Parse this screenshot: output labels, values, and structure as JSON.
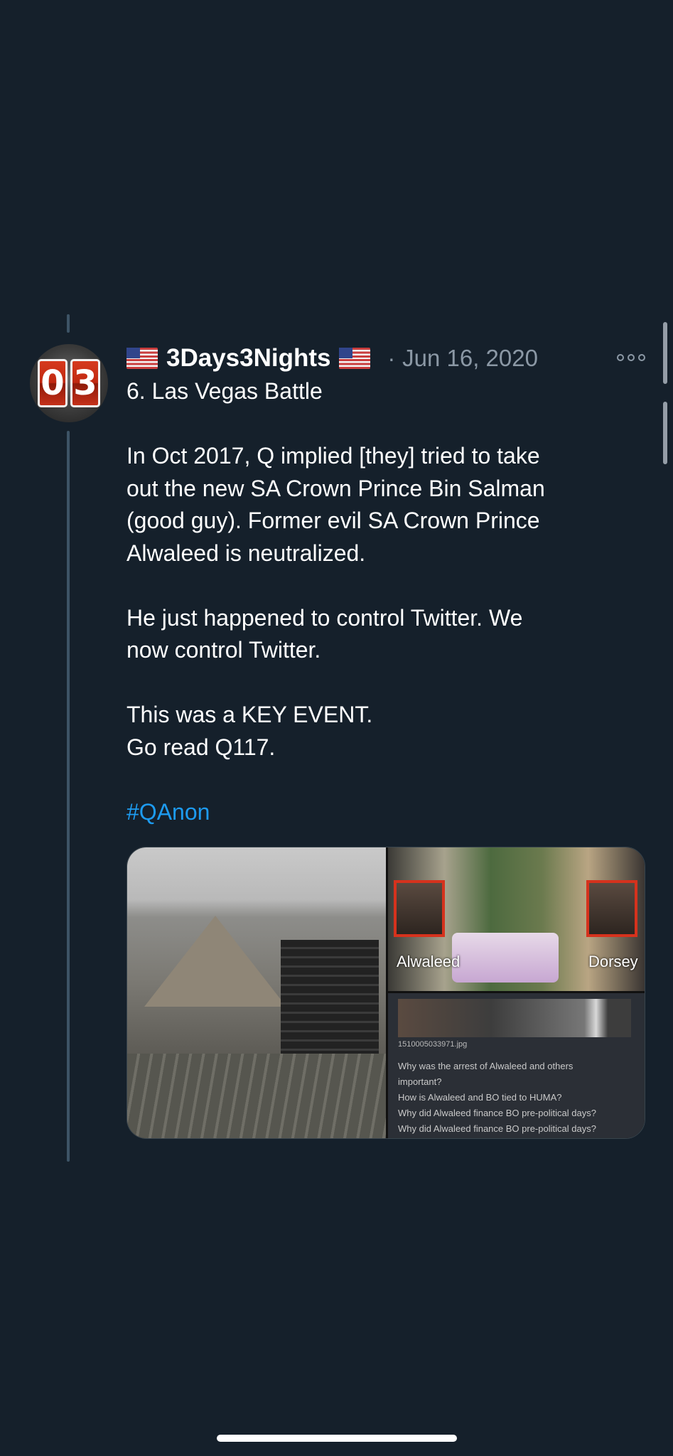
{
  "tweet": {
    "avatar_text": "03",
    "display_name": "3Days3Nights",
    "name_flag_icon": "us-flag-icon",
    "separator": "·",
    "date": "Jun 16, 2020",
    "more_icon": "more-options-icon",
    "text_lines": [
      "6. Las Vegas Battle",
      "",
      "In Oct 2017, Q implied [they] tried to take",
      "out the new SA Crown Prince Bin Salman",
      "(good guy). Former evil SA Crown Prince",
      "Alwaleed is neutralized.",
      "",
      "He just happened to control Twitter. We",
      "now control Twitter.",
      "",
      "This was a KEY EVENT.",
      "Go read Q117.",
      ""
    ],
    "hashtag": "#QAnon",
    "hashtag_color": "#1d9bf0",
    "media": {
      "label_left_person": "Alwaleed",
      "label_right_person": "Dorsey",
      "filename": "1510005033971.jpg",
      "questions": [
        "Why was the arrest of Alwaleed and others",
        "important?",
        "How is Alwaleed and BO tied to HUMA?",
        "Why did Alwaleed finance BO pre-political days?",
        "Why did Alwaleed finance BO pre-political days?"
      ]
    }
  },
  "colors": {
    "background": "#15202b",
    "text": "#ffffff",
    "secondary_text": "#8b98a5",
    "thread_line": "#3d5466"
  }
}
